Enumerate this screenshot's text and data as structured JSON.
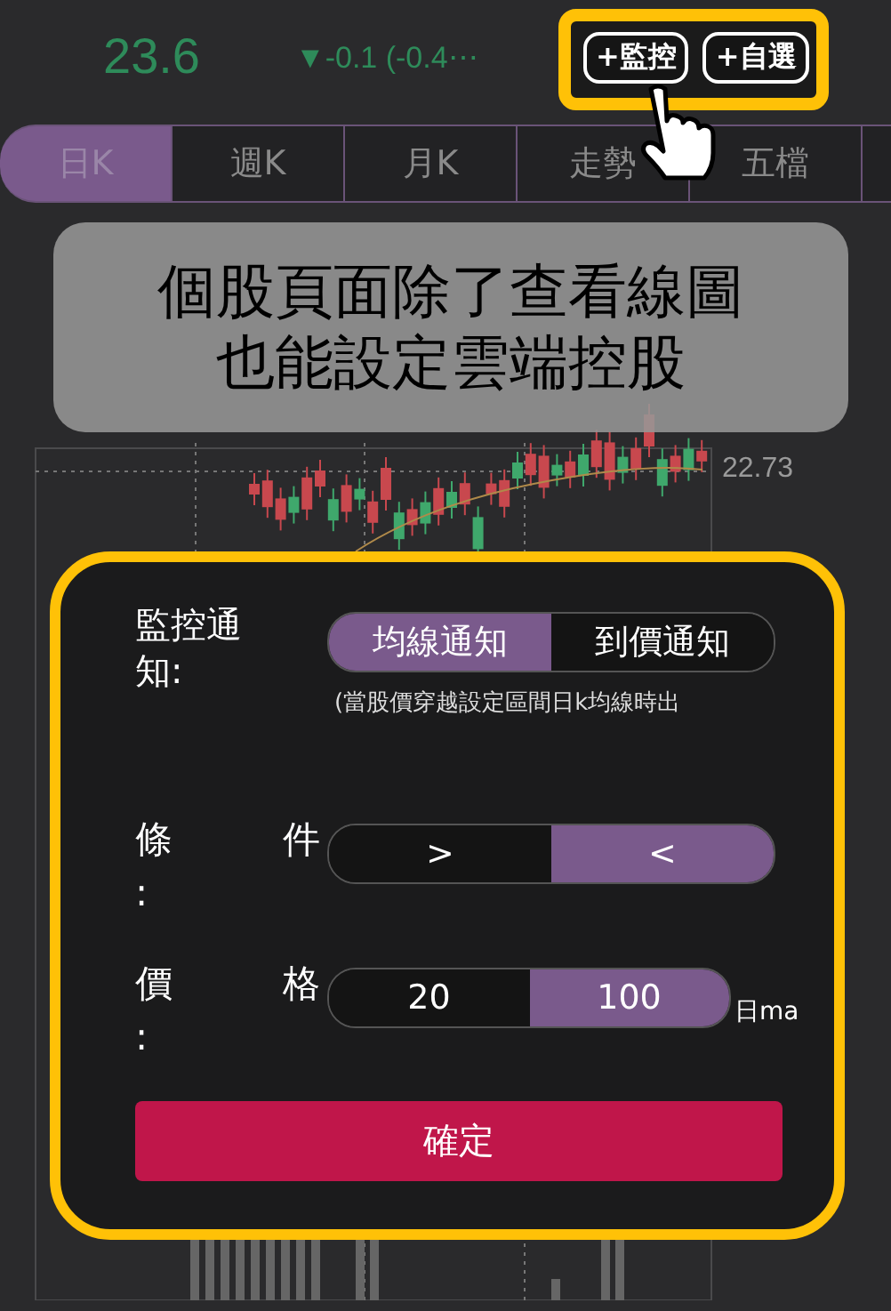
{
  "quote": {
    "price": "23.6",
    "change": "▼-0.1 (-0.4⋯"
  },
  "actions": [
    {
      "label": "+監控"
    },
    {
      "label": "+自選"
    }
  ],
  "tabs": [
    {
      "label": "日K",
      "selected": true
    },
    {
      "label": "週K",
      "selected": false
    },
    {
      "label": "月K",
      "selected": false
    },
    {
      "label": "走勢",
      "selected": false
    },
    {
      "label": "五檔",
      "selected": false
    }
  ],
  "chart": {
    "price_label": "22.73"
  },
  "caption": [
    "個股頁面除了查看線圖",
    "也能設定雲端控股"
  ],
  "dialog": {
    "rows": [
      {
        "label": "監控通知:",
        "options": [
          {
            "label": "均線通知",
            "selected": true
          },
          {
            "label": "到價通知",
            "selected": false
          }
        ],
        "note": "(當股價穿越設定區間日k均線時出"
      },
      {
        "label": "條件:",
        "options": [
          {
            "label": ">",
            "selected": false
          },
          {
            "label": "<",
            "selected": true
          }
        ]
      },
      {
        "label": "價格:",
        "options": [
          {
            "label": "20",
            "selected": false
          },
          {
            "label": "100",
            "selected": true
          }
        ],
        "unit": "日ma"
      }
    ],
    "confirm": "確定"
  }
}
